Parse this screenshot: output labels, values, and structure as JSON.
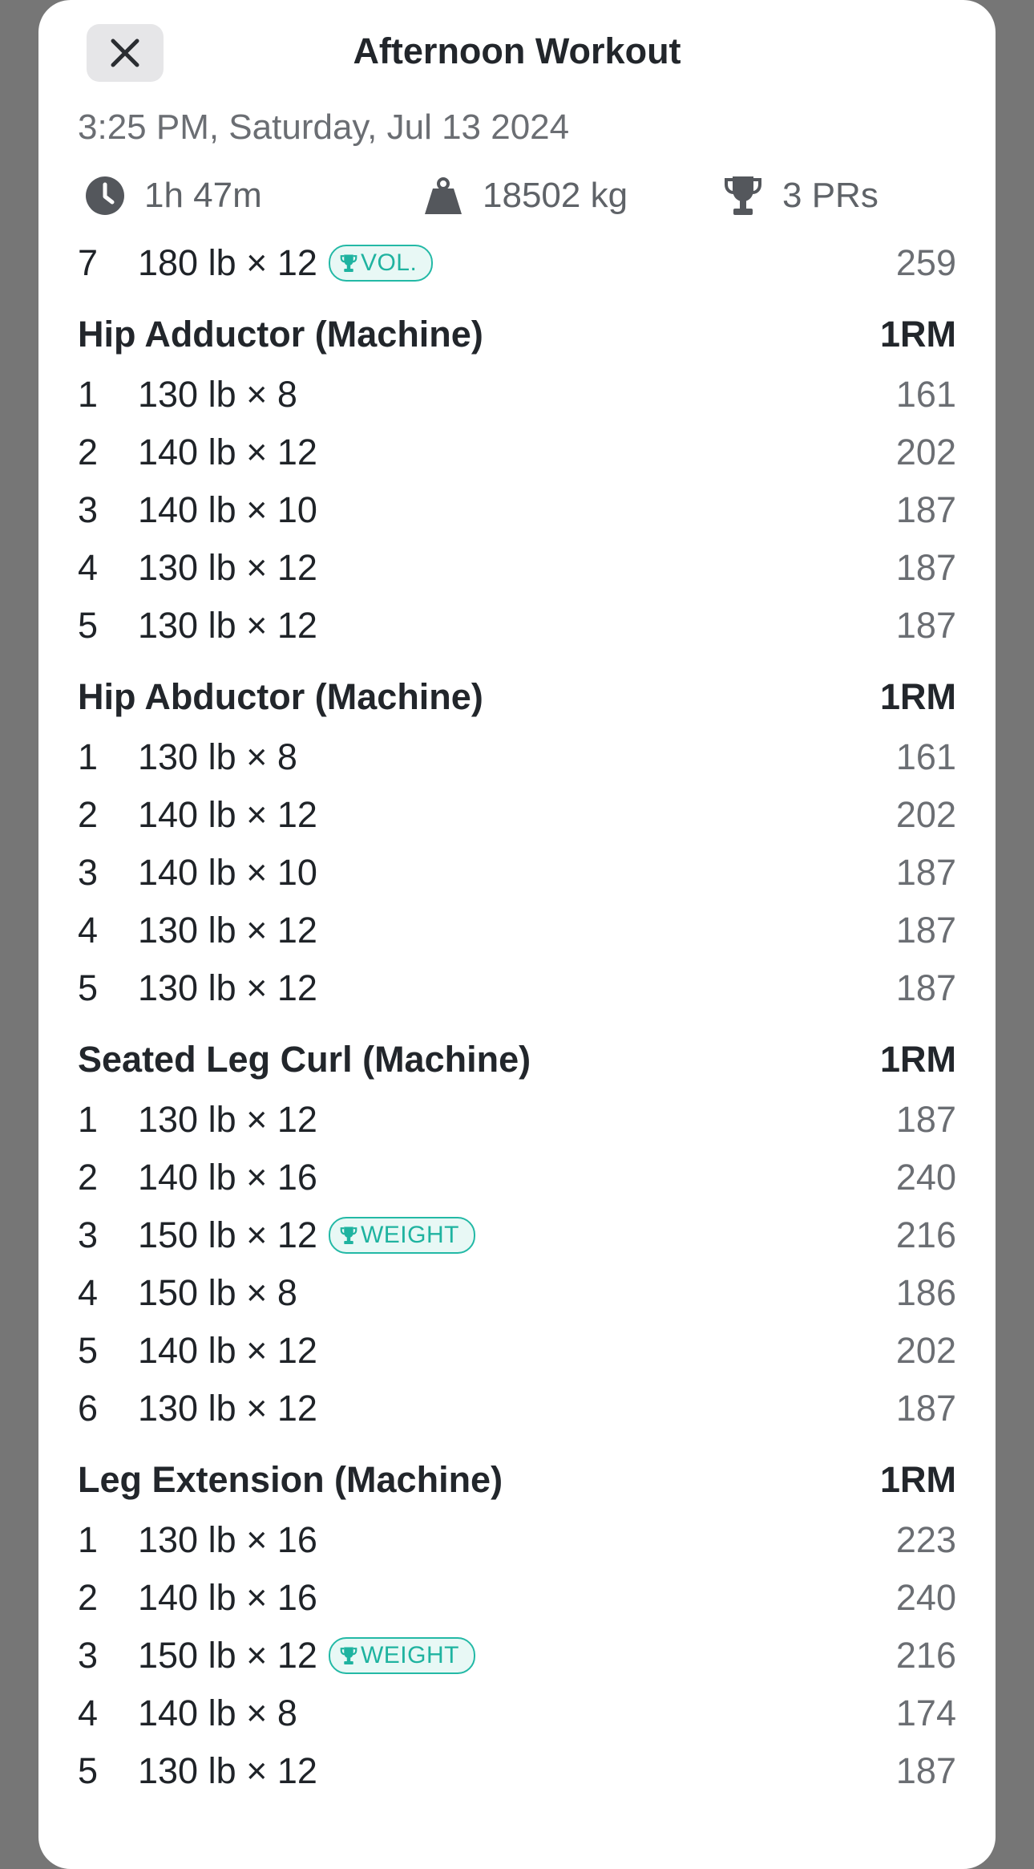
{
  "header": {
    "title": "Afternoon Workout",
    "datetime": "3:25 PM, Saturday, Jul 13 2024"
  },
  "stats": {
    "duration": "1h 47m",
    "volume": "18502 kg",
    "prs": "3 PRs"
  },
  "colors": {
    "accent": "#23b9a6",
    "overlay": "#767676"
  },
  "icons": {
    "close": "close-icon",
    "clock": "clock-icon",
    "weight": "weight-icon",
    "trophy": "trophy-icon"
  },
  "partial_set": {
    "num": "7",
    "weight": "180 lb × 12",
    "badge": "VOL.",
    "orm": "259"
  },
  "exercises": [
    {
      "name": "Hip Adductor (Machine)",
      "col": "1RM",
      "sets": [
        {
          "num": "1",
          "weight": "130 lb × 8",
          "orm": "161"
        },
        {
          "num": "2",
          "weight": "140 lb × 12",
          "orm": "202"
        },
        {
          "num": "3",
          "weight": "140 lb × 10",
          "orm": "187"
        },
        {
          "num": "4",
          "weight": "130 lb × 12",
          "orm": "187"
        },
        {
          "num": "5",
          "weight": "130 lb × 12",
          "orm": "187"
        }
      ]
    },
    {
      "name": "Hip Abductor (Machine)",
      "col": "1RM",
      "sets": [
        {
          "num": "1",
          "weight": "130 lb × 8",
          "orm": "161"
        },
        {
          "num": "2",
          "weight": "140 lb × 12",
          "orm": "202"
        },
        {
          "num": "3",
          "weight": "140 lb × 10",
          "orm": "187"
        },
        {
          "num": "4",
          "weight": "130 lb × 12",
          "orm": "187"
        },
        {
          "num": "5",
          "weight": "130 lb × 12",
          "orm": "187"
        }
      ]
    },
    {
      "name": "Seated Leg Curl (Machine)",
      "col": "1RM",
      "sets": [
        {
          "num": "1",
          "weight": "130 lb × 12",
          "orm": "187"
        },
        {
          "num": "2",
          "weight": "140 lb × 16",
          "orm": "240"
        },
        {
          "num": "3",
          "weight": "150 lb × 12",
          "orm": "216",
          "badge": "WEIGHT"
        },
        {
          "num": "4",
          "weight": "150 lb × 8",
          "orm": "186"
        },
        {
          "num": "5",
          "weight": "140 lb × 12",
          "orm": "202"
        },
        {
          "num": "6",
          "weight": "130 lb × 12",
          "orm": "187"
        }
      ]
    },
    {
      "name": "Leg Extension (Machine)",
      "col": "1RM",
      "sets": [
        {
          "num": "1",
          "weight": "130 lb × 16",
          "orm": "223"
        },
        {
          "num": "2",
          "weight": "140 lb × 16",
          "orm": "240"
        },
        {
          "num": "3",
          "weight": "150 lb × 12",
          "orm": "216",
          "badge": "WEIGHT"
        },
        {
          "num": "4",
          "weight": "140 lb × 8",
          "orm": "174"
        },
        {
          "num": "5",
          "weight": "130 lb × 12",
          "orm": "187"
        }
      ]
    }
  ]
}
